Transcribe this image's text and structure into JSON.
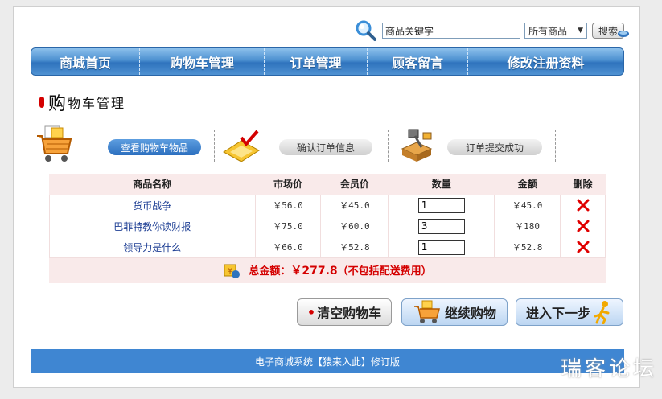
{
  "search": {
    "value": "商品关键字",
    "category": "所有商品",
    "button_label": "搜索"
  },
  "nav": {
    "items": [
      {
        "label": "商城首页"
      },
      {
        "label": "购物车管理"
      },
      {
        "label": "订单管理"
      },
      {
        "label": "顾客留言"
      },
      {
        "label": "修改注册资料"
      }
    ]
  },
  "page_title": {
    "first_char": "购",
    "rest": "物车管理"
  },
  "steps": {
    "view_cart": "查看购物车物品",
    "confirm_order": "确认订单信息",
    "order_success": "订单提交成功"
  },
  "cart": {
    "headers": {
      "name": "商品名称",
      "market_price": "市场价",
      "member_price": "会员价",
      "quantity": "数量",
      "amount": "金额",
      "delete": "删除"
    },
    "rows": [
      {
        "name": "货币战争",
        "market_price": "￥56.0",
        "member_price": "￥45.0",
        "quantity": "1",
        "amount": "￥45.0"
      },
      {
        "name": "巴菲特教你读财报",
        "market_price": "￥75.0",
        "member_price": "￥60.0",
        "quantity": "3",
        "amount": "￥180"
      },
      {
        "name": "领导力是什么",
        "market_price": "￥66.0",
        "member_price": "￥52.8",
        "quantity": "1",
        "amount": "￥52.8"
      }
    ],
    "total_label": "总金额：",
    "total_amount": "￥277.8",
    "total_note": "（不包括配送费用）"
  },
  "actions": {
    "clear": "清空购物车",
    "continue": "继续购物",
    "next": "进入下一步"
  },
  "footer": {
    "text": "电子商城系统【猿来入此】修订版"
  },
  "watermark": "瑞客论坛",
  "colors": {
    "nav_blue": "#3f86d2",
    "accent_red": "#d40000",
    "link_blue": "#1e3f94"
  }
}
